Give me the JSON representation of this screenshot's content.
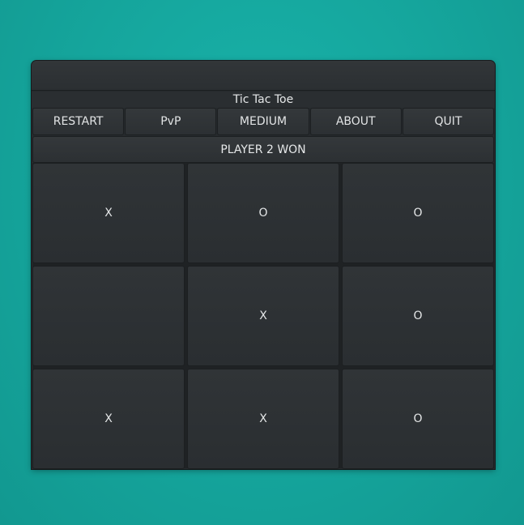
{
  "window": {
    "title": "Tic Tac Toe"
  },
  "toolbar": {
    "restart_label": "RESTART",
    "mode_label": "PvP",
    "difficulty_label": "MEDIUM",
    "about_label": "ABOUT",
    "quit_label": "QUIT"
  },
  "status": {
    "text": "PLAYER 2 WON"
  },
  "board": {
    "cells": [
      "X",
      "O",
      "O",
      "",
      "X",
      "O",
      "X",
      "X",
      "O"
    ]
  },
  "colors": {
    "desktop_background": "#17a89f",
    "window_background": "#2c3033",
    "text": "#e4e6e7"
  }
}
